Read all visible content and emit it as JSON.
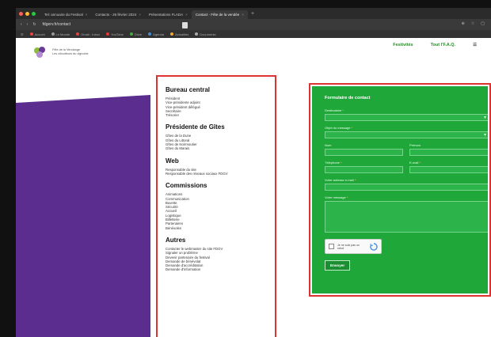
{
  "browser": {
    "tabs": [
      {
        "label": "Tel: annuaire du Festival",
        "active": false
      },
      {
        "label": "Contacts - 26 février 2024",
        "active": false
      },
      {
        "label": "Présentations FLADA",
        "active": false
      },
      {
        "label": "Contact - Fête de la vendée",
        "active": true
      }
    ],
    "new_tab": "+",
    "url": "fdgerv.fr/contact",
    "bookmarks": [
      "Accueil",
      "Le Monde",
      "Gmail - Inbox",
      "YouTube",
      "Drive",
      "Agenda",
      "Actualités",
      "Documents"
    ],
    "colors": {
      "close": "#ff5f57",
      "minimize": "#febc2e",
      "maximize": "#28c840"
    }
  },
  "site": {
    "org_name_line1": "Fête de la Vendange",
    "org_name_line2": "Les viticulteurs du vignoble",
    "nav": [
      "Festivités",
      "Tout l'F.A.Q.",
      "☰"
    ]
  },
  "directory": {
    "sections": [
      {
        "title": "Bureau central",
        "items": [
          "Président",
          "Vice-présidente adjoint",
          "Vice-président délégué",
          "Secrétaire",
          "Trésorier"
        ]
      },
      {
        "title": "Présidente de Gîtes",
        "items": [
          "Gîtes de la Dune",
          "Gîtes du Littoral",
          "Gîtes de Noirmoutier",
          "Gîtes du Marais"
        ]
      },
      {
        "title": "Web",
        "items": [
          "Responsable du site",
          "Responsable des réseaux sociaux FDGV"
        ]
      },
      {
        "title": "Commissions",
        "items": [
          "Animations",
          "Communication",
          "Buvette",
          "Sécurité",
          "Accueil",
          "Logistique",
          "Billetterie",
          "Partenaires",
          "Bénévoles"
        ]
      },
      {
        "title": "Autres",
        "items": [
          "Contacter le webmaster du site FDGV",
          "Signaler un problème",
          "Devenir partenaire du festival",
          "Demande de bénévolat",
          "Demande d'accréditation",
          "Demande d'information"
        ]
      }
    ]
  },
  "form": {
    "title": "Formulaire de contact",
    "fields": {
      "recipient": {
        "label": "Destinataire"
      },
      "subject": {
        "label": "Objet du message"
      },
      "lastname": {
        "label": "Nom"
      },
      "firstname": {
        "label": "Prénom"
      },
      "phone": {
        "label": "Téléphone"
      },
      "email": {
        "label": "E-mail"
      },
      "address": {
        "label": "Votre adresse e-mail"
      },
      "message": {
        "label": "Votre message"
      }
    },
    "required_mark": "*",
    "captcha_label": "Je ne suis pas un robot",
    "submit_label": "Envoyer",
    "accent": "#1fa73a"
  }
}
